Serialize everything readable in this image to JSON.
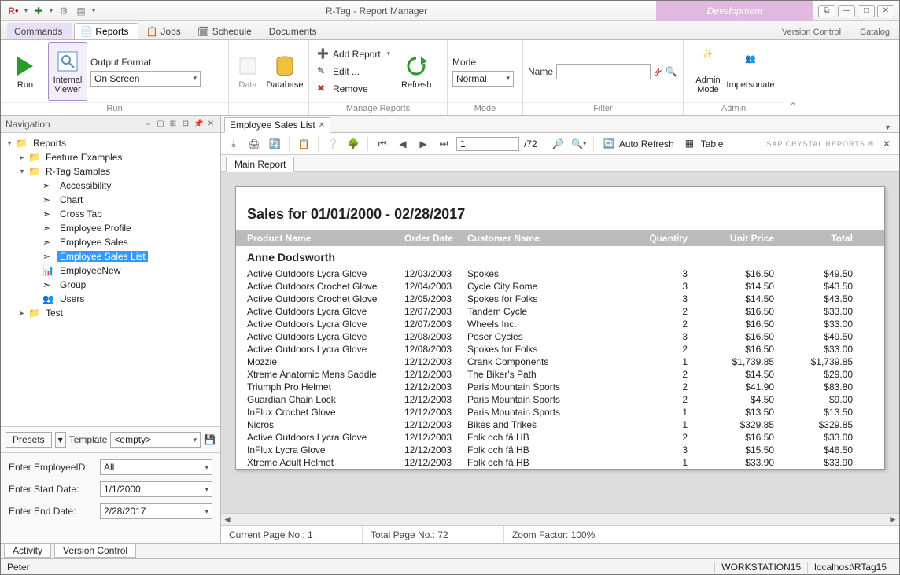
{
  "app": {
    "title": "R-Tag - Report Manager",
    "dev_badge": "Development"
  },
  "window_buttons": [
    "⧉",
    "—",
    "□",
    "✕"
  ],
  "qat_icons": [
    "R",
    "add",
    "gear",
    "list"
  ],
  "menu_tabs": [
    {
      "label": "Commands",
      "active": false,
      "icon": ""
    },
    {
      "label": "Reports",
      "active": true,
      "icon": "📄"
    },
    {
      "label": "Jobs",
      "active": false,
      "icon": "🗂"
    },
    {
      "label": "Schedule",
      "active": false,
      "icon": "🗓"
    },
    {
      "label": "Documents",
      "active": false,
      "icon": ""
    }
  ],
  "menu_right": {
    "version_control": "Version Control",
    "catalog": "Catalog"
  },
  "ribbon": {
    "run": {
      "label": "Run",
      "run_btn": "Run",
      "internal_viewer": "Internal Viewer",
      "output_format_label": "Output Format",
      "output_format_value": "On Screen"
    },
    "data": {
      "data": "Data",
      "database": "Database"
    },
    "manage": {
      "label": "Manage Reports",
      "add": "Add Report",
      "edit": "Edit ...",
      "remove": "Remove",
      "refresh": "Refresh"
    },
    "mode": {
      "label": "Mode",
      "mode_label": "Mode",
      "mode_value": "Normal"
    },
    "filter": {
      "label": "Filter",
      "name_label": "Name",
      "name_value": ""
    },
    "admin": {
      "label": "Admin",
      "admin_mode": "Admin Mode",
      "impersonate": "Impersonate"
    }
  },
  "navigation": {
    "title": "Navigation",
    "tree": [
      {
        "depth": 0,
        "exp": "▾",
        "icon": "📁",
        "label": "Reports"
      },
      {
        "depth": 1,
        "exp": "▸",
        "icon": "📁",
        "label": "Feature Examples"
      },
      {
        "depth": 1,
        "exp": "▾",
        "icon": "📁",
        "label": "R-Tag Samples"
      },
      {
        "depth": 2,
        "exp": "",
        "icon": "➣",
        "label": "Accessibility"
      },
      {
        "depth": 2,
        "exp": "",
        "icon": "➣",
        "label": "Chart"
      },
      {
        "depth": 2,
        "exp": "",
        "icon": "➣",
        "label": "Cross Tab"
      },
      {
        "depth": 2,
        "exp": "",
        "icon": "➣",
        "label": "Employee  Profile"
      },
      {
        "depth": 2,
        "exp": "",
        "icon": "➣",
        "label": "Employee  Sales"
      },
      {
        "depth": 2,
        "exp": "",
        "icon": "➣",
        "label": "Employee Sales List",
        "selected": true
      },
      {
        "depth": 2,
        "exp": "",
        "icon": "📊",
        "label": "EmployeeNew"
      },
      {
        "depth": 2,
        "exp": "",
        "icon": "➣",
        "label": "Group"
      },
      {
        "depth": 2,
        "exp": "",
        "icon": "👥",
        "label": "Users"
      },
      {
        "depth": 1,
        "exp": "▸",
        "icon": "📁",
        "label": "Test"
      }
    ],
    "presets_label": "Presets",
    "template_label": "Template",
    "template_value": "<empty>",
    "params": [
      {
        "label": "Enter EmployeeID:",
        "value": "All"
      },
      {
        "label": "Enter Start Date:",
        "value": "1/1/2000"
      },
      {
        "label": "Enter End Date:",
        "value": "2/28/2017"
      }
    ]
  },
  "doc": {
    "tab_label": "Employee Sales List",
    "toolbar": {
      "page_current": "1",
      "page_total": "/72",
      "auto_refresh": "Auto Refresh",
      "table": "Table",
      "brand": "SAP CRYSTAL REPORTS ®"
    },
    "subtab": "Main Report"
  },
  "report": {
    "title": "Sales for 01/01/2000 - 02/28/2017",
    "columns": [
      "Product Name",
      "Order Date",
      "Customer Name",
      "Quantity",
      "Unit Price",
      "Total"
    ],
    "section": "Anne Dodsworth",
    "rows": [
      [
        "Active Outdoors Lycra Glove",
        "12/03/2003",
        "Spokes",
        "3",
        "$16.50",
        "$49.50"
      ],
      [
        "Active Outdoors Crochet Glove",
        "12/04/2003",
        "Cycle City Rome",
        "3",
        "$14.50",
        "$43.50"
      ],
      [
        "Active Outdoors Crochet Glove",
        "12/05/2003",
        "Spokes for Folks",
        "3",
        "$14.50",
        "$43.50"
      ],
      [
        "Active Outdoors Lycra Glove",
        "12/07/2003",
        "Tandem Cycle",
        "2",
        "$16.50",
        "$33.00"
      ],
      [
        "Active Outdoors Lycra Glove",
        "12/07/2003",
        "Wheels Inc.",
        "2",
        "$16.50",
        "$33.00"
      ],
      [
        "Active Outdoors Lycra Glove",
        "12/08/2003",
        "Poser Cycles",
        "3",
        "$16.50",
        "$49.50"
      ],
      [
        "Active Outdoors Lycra Glove",
        "12/08/2003",
        "Spokes for Folks",
        "2",
        "$16.50",
        "$33.00"
      ],
      [
        "Mozzie",
        "12/12/2003",
        "Crank Components",
        "1",
        "$1,739.85",
        "$1,739.85"
      ],
      [
        "Xtreme Anatomic Mens Saddle",
        "12/12/2003",
        "The Biker's Path",
        "2",
        "$14.50",
        "$29.00"
      ],
      [
        "Triumph Pro Helmet",
        "12/12/2003",
        "Paris Mountain Sports",
        "2",
        "$41.90",
        "$83.80"
      ],
      [
        "Guardian Chain Lock",
        "12/12/2003",
        "Paris Mountain Sports",
        "2",
        "$4.50",
        "$9.00"
      ],
      [
        "InFlux Crochet Glove",
        "12/12/2003",
        "Paris Mountain Sports",
        "1",
        "$13.50",
        "$13.50"
      ],
      [
        "Nicros",
        "12/12/2003",
        "Bikes and Trikes",
        "1",
        "$329.85",
        "$329.85"
      ],
      [
        "Active Outdoors Lycra Glove",
        "12/12/2003",
        "Folk och fä HB",
        "2",
        "$16.50",
        "$33.00"
      ],
      [
        "InFlux Lycra Glove",
        "12/12/2003",
        "Folk och fä HB",
        "3",
        "$15.50",
        "$46.50"
      ],
      [
        "Xtreme Adult Helmet",
        "12/12/2003",
        "Folk och fä HB",
        "1",
        "$33.90",
        "$33.90"
      ]
    ]
  },
  "viewer_status": {
    "current_page": "Current Page No.: 1",
    "total_page": "Total Page No.: 72",
    "zoom": "Zoom Factor: 100%"
  },
  "bottom_tabs": [
    "Activity",
    "Version Control"
  ],
  "statusbar": {
    "user": "Peter",
    "workstation": "WORKSTATION15",
    "db": "localhost\\RTag15"
  }
}
